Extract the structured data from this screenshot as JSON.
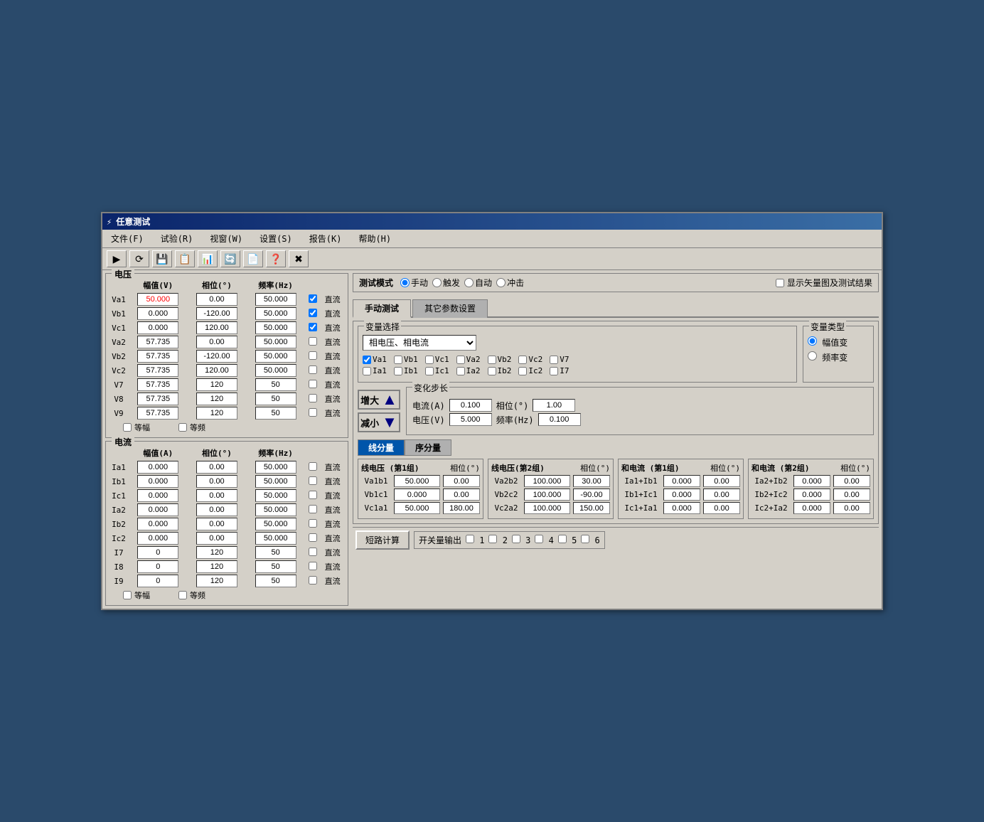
{
  "window": {
    "title": "任意测试",
    "title_icon": "⚡"
  },
  "menu": {
    "items": [
      "文件(F)",
      "试验(R)",
      "视窗(W)",
      "设置(S)",
      "报告(K)",
      "帮助(H)"
    ]
  },
  "toolbar": {
    "buttons": [
      "▶",
      "⭮",
      "💾",
      "📋",
      "📊",
      "🔄",
      "📋",
      "❓",
      "✖"
    ]
  },
  "voltage_table": {
    "title": "电压",
    "headers": [
      "幅值(V)",
      "相位(°)",
      "频率(Hz)"
    ],
    "rows": [
      {
        "label": "Va1",
        "amplitude": "50.000",
        "phase": "0.00",
        "frequency": "50.000",
        "dc_checked": true,
        "is_red": true
      },
      {
        "label": "Vb1",
        "amplitude": "0.000",
        "phase": "-120.00",
        "frequency": "50.000",
        "dc_checked": true,
        "is_red": false
      },
      {
        "label": "Vc1",
        "amplitude": "0.000",
        "phase": "120.00",
        "frequency": "50.000",
        "dc_checked": true,
        "is_red": false
      },
      {
        "label": "Va2",
        "amplitude": "57.735",
        "phase": "0.00",
        "frequency": "50.000",
        "dc_checked": false,
        "is_red": false
      },
      {
        "label": "Vb2",
        "amplitude": "57.735",
        "phase": "-120.00",
        "frequency": "50.000",
        "dc_checked": false,
        "is_red": false
      },
      {
        "label": "Vc2",
        "amplitude": "57.735",
        "phase": "120.00",
        "frequency": "50.000",
        "dc_checked": false,
        "is_red": false
      },
      {
        "label": "V7",
        "amplitude": "57.735",
        "phase": "120",
        "frequency": "50",
        "dc_checked": false,
        "is_red": false
      },
      {
        "label": "V8",
        "amplitude": "57.735",
        "phase": "120",
        "frequency": "50",
        "dc_checked": false,
        "is_red": false
      },
      {
        "label": "V9",
        "amplitude": "57.735",
        "phase": "120",
        "frequency": "50",
        "dc_checked": false,
        "is_red": false
      }
    ],
    "dc_label": "直流",
    "bottom_equal_amp": "等幅",
    "bottom_equal_freq": "等频"
  },
  "current_table": {
    "title": "电流",
    "headers": [
      "幅值(A)",
      "相位(°)",
      "频率(Hz)"
    ],
    "rows": [
      {
        "label": "Ia1",
        "amplitude": "0.000",
        "phase": "0.00",
        "frequency": "50.000",
        "dc_checked": false
      },
      {
        "label": "Ib1",
        "amplitude": "0.000",
        "phase": "0.00",
        "frequency": "50.000",
        "dc_checked": false
      },
      {
        "label": "Ic1",
        "amplitude": "0.000",
        "phase": "0.00",
        "frequency": "50.000",
        "dc_checked": false
      },
      {
        "label": "Ia2",
        "amplitude": "0.000",
        "phase": "0.00",
        "frequency": "50.000",
        "dc_checked": false
      },
      {
        "label": "Ib2",
        "amplitude": "0.000",
        "phase": "0.00",
        "frequency": "50.000",
        "dc_checked": false
      },
      {
        "label": "Ic2",
        "amplitude": "0.000",
        "phase": "0.00",
        "frequency": "50.000",
        "dc_checked": false
      },
      {
        "label": "I7",
        "amplitude": "0",
        "phase": "120",
        "frequency": "50",
        "dc_checked": false
      },
      {
        "label": "I8",
        "amplitude": "0",
        "phase": "120",
        "frequency": "50",
        "dc_checked": false
      },
      {
        "label": "I9",
        "amplitude": "0",
        "phase": "120",
        "frequency": "50",
        "dc_checked": false
      }
    ],
    "dc_label": "直流",
    "bottom_equal_amp": "等幅",
    "bottom_equal_freq": "等频"
  },
  "test_mode": {
    "label": "测试模式",
    "options": [
      "手动",
      "触发",
      "自动",
      "冲击"
    ],
    "selected": "手动",
    "show_vector_label": "显示矢量图及测试结果"
  },
  "tabs": {
    "manual_label": "手动测试",
    "other_label": "其它参数设置"
  },
  "variable_select": {
    "title": "变量选择",
    "dropdown_value": "相电压、相电流",
    "checkboxes_row1": [
      "Va1",
      "Vb1",
      "Vc1",
      "Va2",
      "Vb2",
      "Vc2",
      "V7"
    ],
    "checkboxes_row2": [
      "Ia1",
      "Ib1",
      "Ic1",
      "Ia2",
      "Ib2",
      "Ic2",
      "I7"
    ],
    "checked_row1": [
      true,
      false,
      false,
      false,
      false,
      false,
      false
    ],
    "checked_row2": [
      false,
      false,
      false,
      false,
      false,
      false,
      false
    ]
  },
  "var_type": {
    "title": "变量类型",
    "options": [
      "幅值变",
      "频率变"
    ],
    "selected": "幅值变"
  },
  "increase_decrease": {
    "increase_label": "增大",
    "decrease_label": "减小"
  },
  "step_change": {
    "title": "变化步长",
    "current_label": "电流(A)",
    "current_value": "0.100",
    "phase_label": "相位(°)",
    "phase_value": "1.00",
    "voltage_label": "电压(V)",
    "voltage_value": "5.000",
    "freq_label": "频率(Hz)",
    "freq_value": "0.100"
  },
  "seq_tabs": {
    "line_label": "线分量",
    "seq_label": "序分量"
  },
  "line_voltage_group1": {
    "title": "线电压 (第1组)",
    "phase_header": "相位(°)",
    "rows": [
      {
        "label": "Va1b1",
        "value": "50.000",
        "phase": "0.00"
      },
      {
        "label": "Vb1c1",
        "value": "0.000",
        "phase": "0.00"
      },
      {
        "label": "Vc1a1",
        "value": "50.000",
        "phase": "180.00"
      }
    ]
  },
  "line_voltage_group2": {
    "title": "线电压(第2组)",
    "phase_header": "相位(°)",
    "rows": [
      {
        "label": "Va2b2",
        "value": "100.000",
        "phase": "30.00"
      },
      {
        "label": "Vb2c2",
        "value": "100.000",
        "phase": "-90.00"
      },
      {
        "label": "Vc2a2",
        "value": "100.000",
        "phase": "150.00"
      }
    ]
  },
  "sum_current_group1": {
    "title": "和电流 (第1组)",
    "phase_header": "相位(°)",
    "rows": [
      {
        "label": "Ia1+Ib1",
        "value": "0.000",
        "phase": "0.00"
      },
      {
        "label": "Ib1+Ic1",
        "value": "0.000",
        "phase": "0.00"
      },
      {
        "label": "Ic1+Ia1",
        "value": "0.000",
        "phase": "0.00"
      }
    ]
  },
  "sum_current_group2": {
    "title": "和电流 (第2组)",
    "phase_header": "相位(°)",
    "rows": [
      {
        "label": "Ia2+Ib2",
        "value": "0.000",
        "phase": "0.00"
      },
      {
        "label": "Ib2+Ic2",
        "value": "0.000",
        "phase": "0.00"
      },
      {
        "label": "Ic2+Ia2",
        "value": "0.000",
        "phase": "0.00"
      }
    ]
  },
  "bottom_bar": {
    "short_calc_label": "短路计算",
    "switch_output_label": "开关量输出",
    "switches": [
      "1□",
      "2□",
      "3□",
      "4□",
      "5□",
      "6□"
    ]
  }
}
